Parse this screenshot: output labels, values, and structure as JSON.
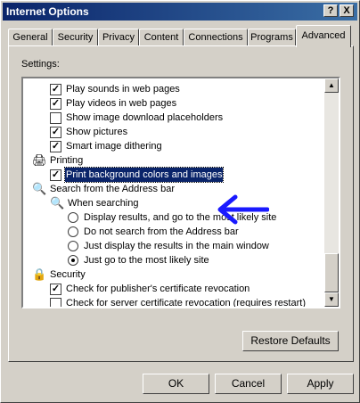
{
  "window": {
    "title": "Internet Options",
    "help_label": "?",
    "close_label": "X"
  },
  "tabs": [
    {
      "label": "General"
    },
    {
      "label": "Security"
    },
    {
      "label": "Privacy"
    },
    {
      "label": "Content"
    },
    {
      "label": "Connections"
    },
    {
      "label": "Programs"
    },
    {
      "label": "Advanced",
      "active": true
    }
  ],
  "settings": {
    "label": "Settings:",
    "items": [
      {
        "type": "checkbox",
        "label": "Play sounds in web pages",
        "checked": true
      },
      {
        "type": "checkbox",
        "label": "Play videos in web pages",
        "checked": true
      },
      {
        "type": "checkbox",
        "label": "Show image download placeholders",
        "checked": false
      },
      {
        "type": "checkbox",
        "label": "Show pictures",
        "checked": true
      },
      {
        "type": "checkbox",
        "label": "Smart image dithering",
        "checked": true
      },
      {
        "type": "group",
        "label": "Printing",
        "icon": "printer-icon"
      },
      {
        "type": "checkbox",
        "label": "Print background colors and images",
        "checked": true,
        "selected": true
      },
      {
        "type": "group",
        "label": "Search from the Address bar",
        "icon": "search-icon"
      },
      {
        "type": "subgroup",
        "label": "When searching",
        "icon": "search-icon"
      },
      {
        "type": "radio",
        "label": "Display results, and go to the most likely site",
        "checked": false
      },
      {
        "type": "radio",
        "label": "Do not search from the Address bar",
        "checked": false
      },
      {
        "type": "radio",
        "label": "Just display the results in the main window",
        "checked": false
      },
      {
        "type": "radio",
        "label": "Just go to the most likely site",
        "checked": true
      },
      {
        "type": "group",
        "label": "Security",
        "icon": "lock-icon"
      },
      {
        "type": "checkbox",
        "label": "Check for publisher's certificate revocation",
        "checked": true
      },
      {
        "type": "checkbox",
        "label": "Check for server certificate revocation (requires restart)",
        "checked": false
      }
    ]
  },
  "buttons": {
    "restore_defaults": "Restore Defaults",
    "ok": "OK",
    "cancel": "Cancel",
    "apply": "Apply"
  },
  "colors": {
    "selection": "#0a246a",
    "annotation_arrow": "#1a1aff"
  }
}
